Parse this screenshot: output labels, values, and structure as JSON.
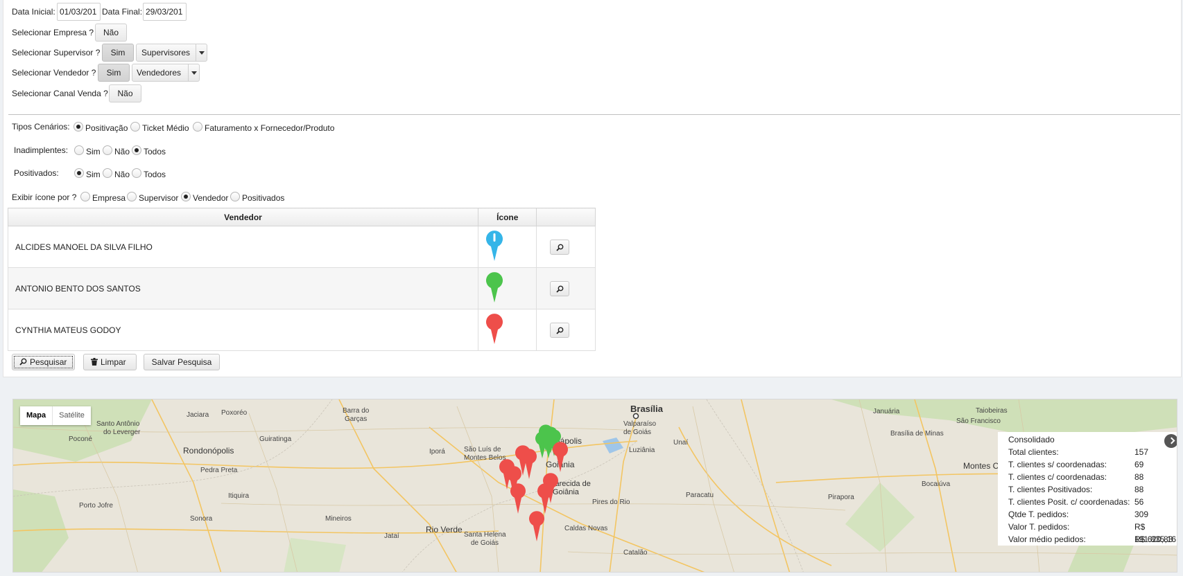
{
  "filters": {
    "data_inicial_label": "Data Inicial:",
    "data_inicial_value": "01/03/201",
    "data_final_label": "Data Final:",
    "data_final_value": "29/03/201",
    "empresa_label": "Selecionar Empresa ?",
    "empresa_toggle": "Não",
    "supervisor_label": "Selecionar Supervisor ?",
    "supervisor_toggle": "Sim",
    "supervisor_select": "Supervisores",
    "vendedor_label": "Selecionar Vendedor ?",
    "vendedor_toggle": "Sim",
    "vendedor_select": "Vendedores",
    "canal_label": "Selecionar Canal Venda ?",
    "canal_toggle": "Não"
  },
  "options": {
    "tipos_label": "Tipos Cenários:",
    "tipos": [
      "Positivação",
      "Ticket Médio",
      "Faturamento x Fornecedor/Produto"
    ],
    "tipos_selected": "Positivação",
    "inadimplentes_label": "Inadimplentes:",
    "inadimplentes": [
      "Sim",
      "Não",
      "Todos"
    ],
    "inadimplentes_selected": "Todos",
    "positivados_label": "Positivados:",
    "positivados": [
      "Sim",
      "Não",
      "Todos"
    ],
    "positivados_selected": "Sim",
    "exibir_label": "Exibir ícone por ?",
    "exibir": [
      "Empresa",
      "Supervisor",
      "Vendedor",
      "Positivados"
    ],
    "exibir_selected": "Vendedor"
  },
  "table": {
    "headers": [
      "Vendedor",
      "Ícone",
      ""
    ],
    "rows": [
      {
        "name": "ALCIDES MANOEL DA SILVA FILHO",
        "icon": "blue-pin-icon",
        "color": "#35b5e8"
      },
      {
        "name": "ANTONIO BENTO DOS SANTOS",
        "icon": "green-pin-icon",
        "color": "#4cc44c"
      },
      {
        "name": "CYNTHIA MATEUS GODOY",
        "icon": "red-pin-icon",
        "color": "#ee4e4a"
      }
    ]
  },
  "actions": {
    "pesquisar": "Pesquisar",
    "limpar": "Limpar",
    "salvar": "Salvar Pesquisa"
  },
  "map": {
    "type_map": "Mapa",
    "type_satellite": "Satélite",
    "cities": [
      "Brasília",
      "Anápolis",
      "Goiânia",
      "Aparecida de Goiânia",
      "Rondonópolis",
      "Jataí",
      "Rio Verde",
      "Montes Claros",
      "Barra do Garças",
      "São Luís de Montes Belos",
      "Luziânia",
      "Caldas Novas",
      "Paracatu",
      "Pires do Rio",
      "Iporá",
      "Catalão",
      "Mineiros",
      "Valparaíso de Goiás",
      "Santa Helena de Goiás",
      "Bocaiúva",
      "Pirapora",
      "São Francisco",
      "Januária",
      "Unaí",
      "Itiquira",
      "Poxoréo",
      "Jaciara",
      "Guiratinga",
      "Sonora",
      "Pedra Preta",
      "Porto Jofre",
      "Santo Antônio do Leverger",
      "Poconé",
      "Taiobeiras",
      "Brasília de Minas"
    ],
    "info": {
      "title": "Consolidado",
      "rows": [
        {
          "label": "Total clientes:",
          "value": "157"
        },
        {
          "label": "T. clientes s/ coordenadas:",
          "value": "69"
        },
        {
          "label": "T. clientes c/ coordenadas:",
          "value": "88"
        },
        {
          "label": "T. clientes Positivados:",
          "value": "88"
        },
        {
          "label": "T. clientes Posit. c/ coordenadas:",
          "value": "56"
        },
        {
          "label": "Qtde T. pedidos:",
          "value": "309"
        },
        {
          "label": "Valor T. pedidos:",
          "value": "R$ 191.835,16"
        },
        {
          "label": "Valor médio pedidos:",
          "value": "R$ 620,83"
        }
      ]
    }
  }
}
